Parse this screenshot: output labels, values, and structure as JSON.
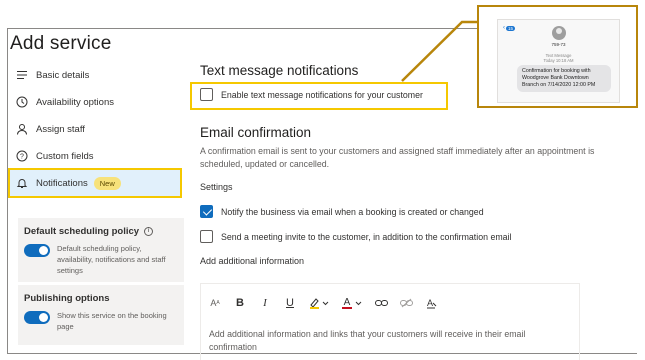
{
  "header": {
    "title": "Add service"
  },
  "sidebar": {
    "items": [
      {
        "label": "Basic details",
        "icon": "list-icon"
      },
      {
        "label": "Availability options",
        "icon": "clock-icon"
      },
      {
        "label": "Assign staff",
        "icon": "person-icon"
      },
      {
        "label": "Custom fields",
        "icon": "question-icon"
      },
      {
        "label": "Notifications",
        "icon": "bell-icon",
        "badge": "New",
        "active": true
      }
    ],
    "scheduling_policy": {
      "title": "Default scheduling policy",
      "description": "Default scheduling policy, availability, notifications and staff settings",
      "toggle_on": true
    },
    "publishing": {
      "title": "Publishing options",
      "description": "Show this service on the booking page",
      "toggle_on": true
    }
  },
  "main": {
    "text_notifications": {
      "heading": "Text message notifications",
      "checkbox_label": "Enable text message notifications for your customer",
      "checked": false
    },
    "email": {
      "heading": "Email confirmation",
      "description": "A confirmation email is sent to your customers and assigned staff immediately after an appointment is scheduled, updated or cancelled.",
      "settings_label": "Settings",
      "options": [
        {
          "label": "Notify the business via email when a booking is created or changed",
          "checked": true
        },
        {
          "label": "Send a meeting invite to the customer, in addition to the confirmation email",
          "checked": false
        }
      ]
    },
    "additional": {
      "heading": "Add additional information",
      "placeholder": "Add additional information and links that your customers will receive in their email confirmation"
    }
  },
  "phone_preview": {
    "back_count": "15",
    "contact": "759-73",
    "meta_line1": "Text Message",
    "meta_line2": "Today 10:18 AM",
    "message": "Confirmation for booking with Woodgrove Bank Downtown Branch on 7/14/2020 12:00 PM"
  },
  "colors": {
    "accent": "#0f6cbd",
    "highlight": "#f5c800",
    "callout": "#b8860b",
    "active_bg": "#e1f0fb"
  }
}
